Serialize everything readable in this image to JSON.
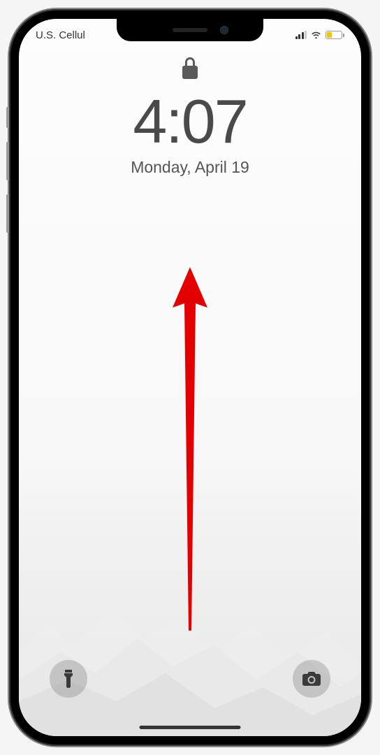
{
  "status": {
    "carrier": "U.S. Cellul",
    "signal_bars": 3,
    "wifi": true,
    "battery_level": 35,
    "battery_color": "#f5c500"
  },
  "lock": {
    "locked": true,
    "time": "4:07",
    "date": "Monday, April 19"
  },
  "buttons": {
    "flashlight": "flashlight",
    "camera": "camera"
  },
  "annotation": {
    "type": "swipe-up-arrow",
    "color": "#e30000"
  }
}
